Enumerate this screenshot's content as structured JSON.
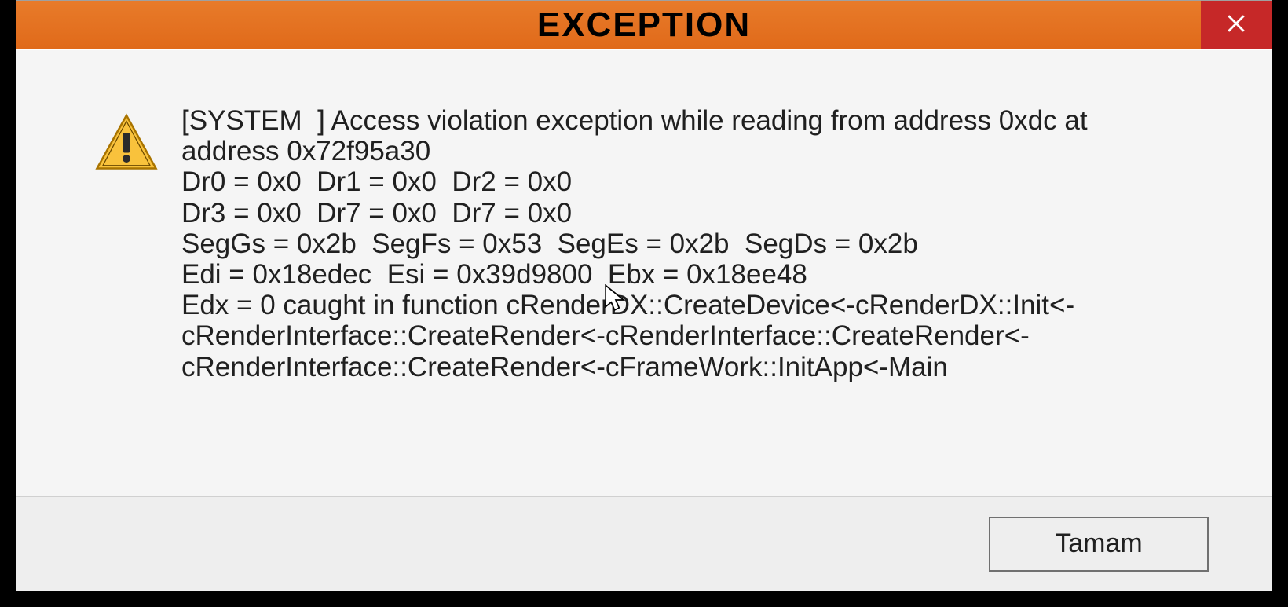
{
  "window": {
    "title": "EXCEPTION"
  },
  "message": {
    "text": "[SYSTEM  ] Access violation exception while reading from address 0xdc at address 0x72f95a30\nDr0 = 0x0  Dr1 = 0x0  Dr2 = 0x0\nDr3 = 0x0  Dr7 = 0x0  Dr7 = 0x0\nSegGs = 0x2b  SegFs = 0x53  SegEs = 0x2b  SegDs = 0x2b\nEdi = 0x18edec  Esi = 0x39d9800  Ebx = 0x18ee48\nEdx = 0 caught in function cRenderDX::CreateDevice<-cRenderDX::Init<-cRenderInterface::CreateRender<-cRenderInterface::CreateRender<-cRenderInterface::CreateRender<-cFrameWork::InitApp<-Main"
  },
  "buttons": {
    "ok_label": "Tamam"
  },
  "colors": {
    "titlebar": "#e06a1a",
    "close": "#c62828"
  }
}
